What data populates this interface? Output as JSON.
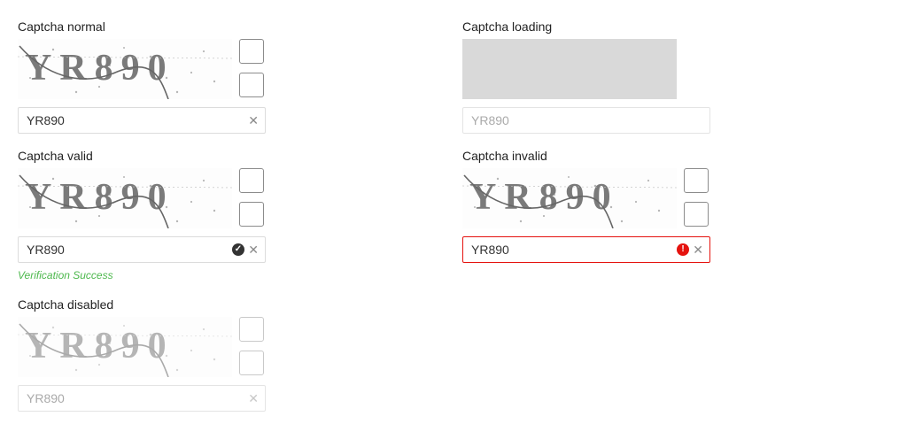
{
  "normal": {
    "label": "Captcha normal",
    "captcha_text": "YR890",
    "value": "YR890"
  },
  "loading": {
    "label": "Captcha loading",
    "value": "YR890"
  },
  "valid": {
    "label": "Captcha valid",
    "captcha_text": "YR890",
    "value": "YR890",
    "help": "Verification Success"
  },
  "invalid": {
    "label": "Captcha invalid",
    "captcha_text": "YR890",
    "value": "YR890"
  },
  "disabled": {
    "label": "Captcha disabled",
    "captcha_text": "YR890",
    "value": "YR890"
  },
  "icons": {
    "clear": "close-icon",
    "valid": "check-circle-icon",
    "invalid": "exclamation-circle-icon"
  },
  "colors": {
    "error": "#e5130f",
    "success": "#4db84d",
    "loading_bg": "#d9d9d9"
  }
}
